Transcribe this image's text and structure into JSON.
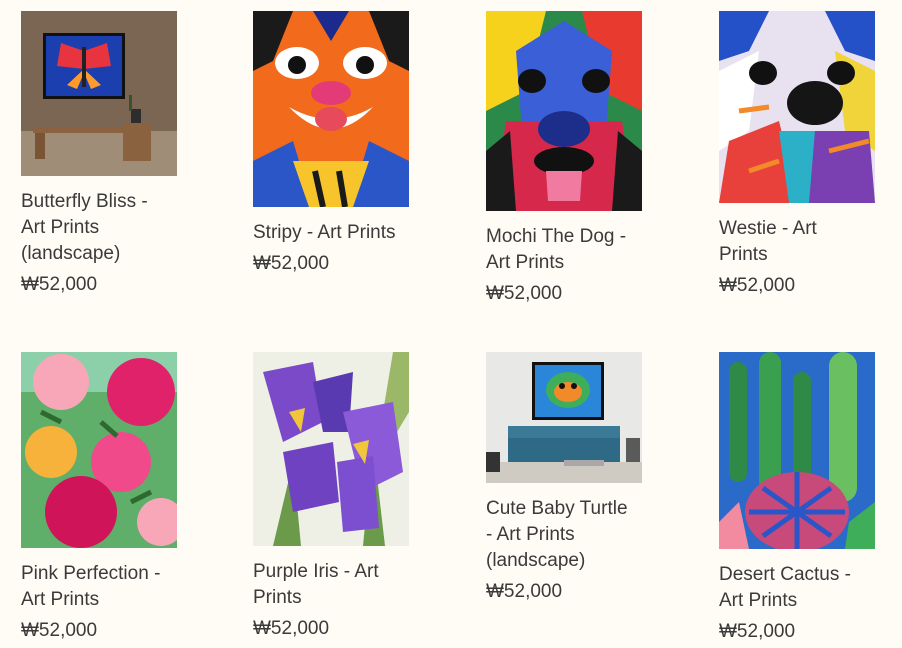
{
  "products": [
    {
      "title": "Butterfly Bliss -\nArt Prints\n(landscape)",
      "price": "₩52,000",
      "image": "butterfly-room-image"
    },
    {
      "title": "Stripy - Art Prints",
      "price": "₩52,000",
      "image": "tiger-painting-image"
    },
    {
      "title": "Mochi The Dog -\nArt Prints",
      "price": "₩52,000",
      "image": "dog-painting-image"
    },
    {
      "title": "Westie - Art\nPrints",
      "price": "₩52,000",
      "image": "westie-painting-image"
    },
    {
      "title": "Pink Perfection -\nArt Prints",
      "price": "₩52,000",
      "image": "pink-flowers-painting-image"
    },
    {
      "title": "Purple Iris - Art\nPrints",
      "price": "₩52,000",
      "image": "iris-painting-image"
    },
    {
      "title": "Cute Baby Turtle\n- Art Prints\n(landscape)",
      "price": "₩52,000",
      "image": "turtle-room-image"
    },
    {
      "title": "Desert Cactus -\nArt Prints",
      "price": "₩52,000",
      "image": "cactus-painting-image"
    }
  ]
}
